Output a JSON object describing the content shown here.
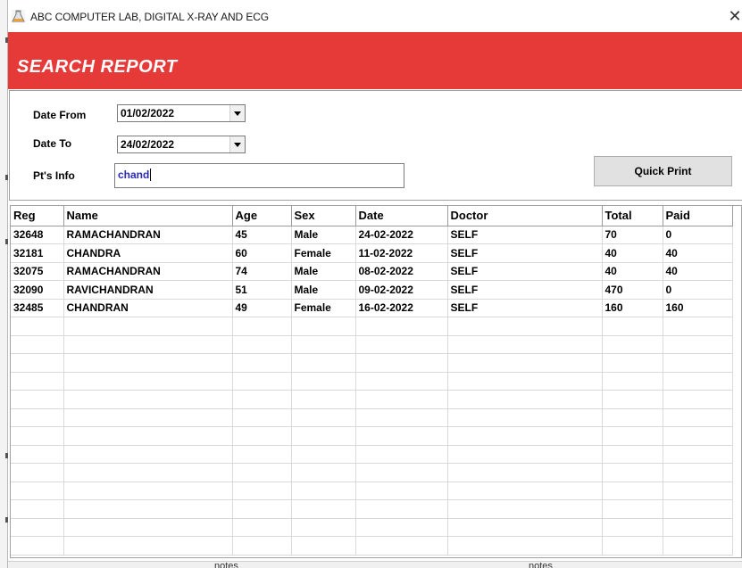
{
  "window": {
    "title": "ABC COMPUTER LAB, DIGITAL X-RAY AND ECG",
    "close_glyph": "✕",
    "app_icon": "lab-flask-icon"
  },
  "header": {
    "title": "SEARCH REPORT",
    "background": "#e63a39"
  },
  "search": {
    "date_from_label": "Date From",
    "date_from_value": "01/02/2022",
    "date_to_label": "Date To",
    "date_to_value": "24/02/2022",
    "info_label": "Pt's Info",
    "info_value": "chand",
    "quick_print_label": "Quick Print"
  },
  "results": {
    "columns": [
      "Reg",
      "Name",
      "Age",
      "Sex",
      "Date",
      "Doctor",
      "Total",
      "Paid"
    ],
    "rows": [
      [
        "32648",
        "RAMACHANDRAN",
        "45",
        "Male",
        "24-02-2022",
        "SELF",
        "70",
        "0"
      ],
      [
        "32181",
        "CHANDRA",
        "60",
        "Female",
        "11-02-2022",
        "SELF",
        "40",
        "40"
      ],
      [
        "32075",
        "RAMACHANDRAN",
        "74",
        "Male",
        "08-02-2022",
        "SELF",
        "40",
        "40"
      ],
      [
        "32090",
        "RAVICHANDRAN",
        "51",
        "Male",
        "09-02-2022",
        "SELF",
        "470",
        "0"
      ],
      [
        "32485",
        "CHANDRAN",
        "49",
        "Female",
        "16-02-2022",
        "SELF",
        "160",
        "160"
      ]
    ]
  },
  "background_window": {
    "bottom_labels": [
      "notes",
      "notes"
    ]
  }
}
